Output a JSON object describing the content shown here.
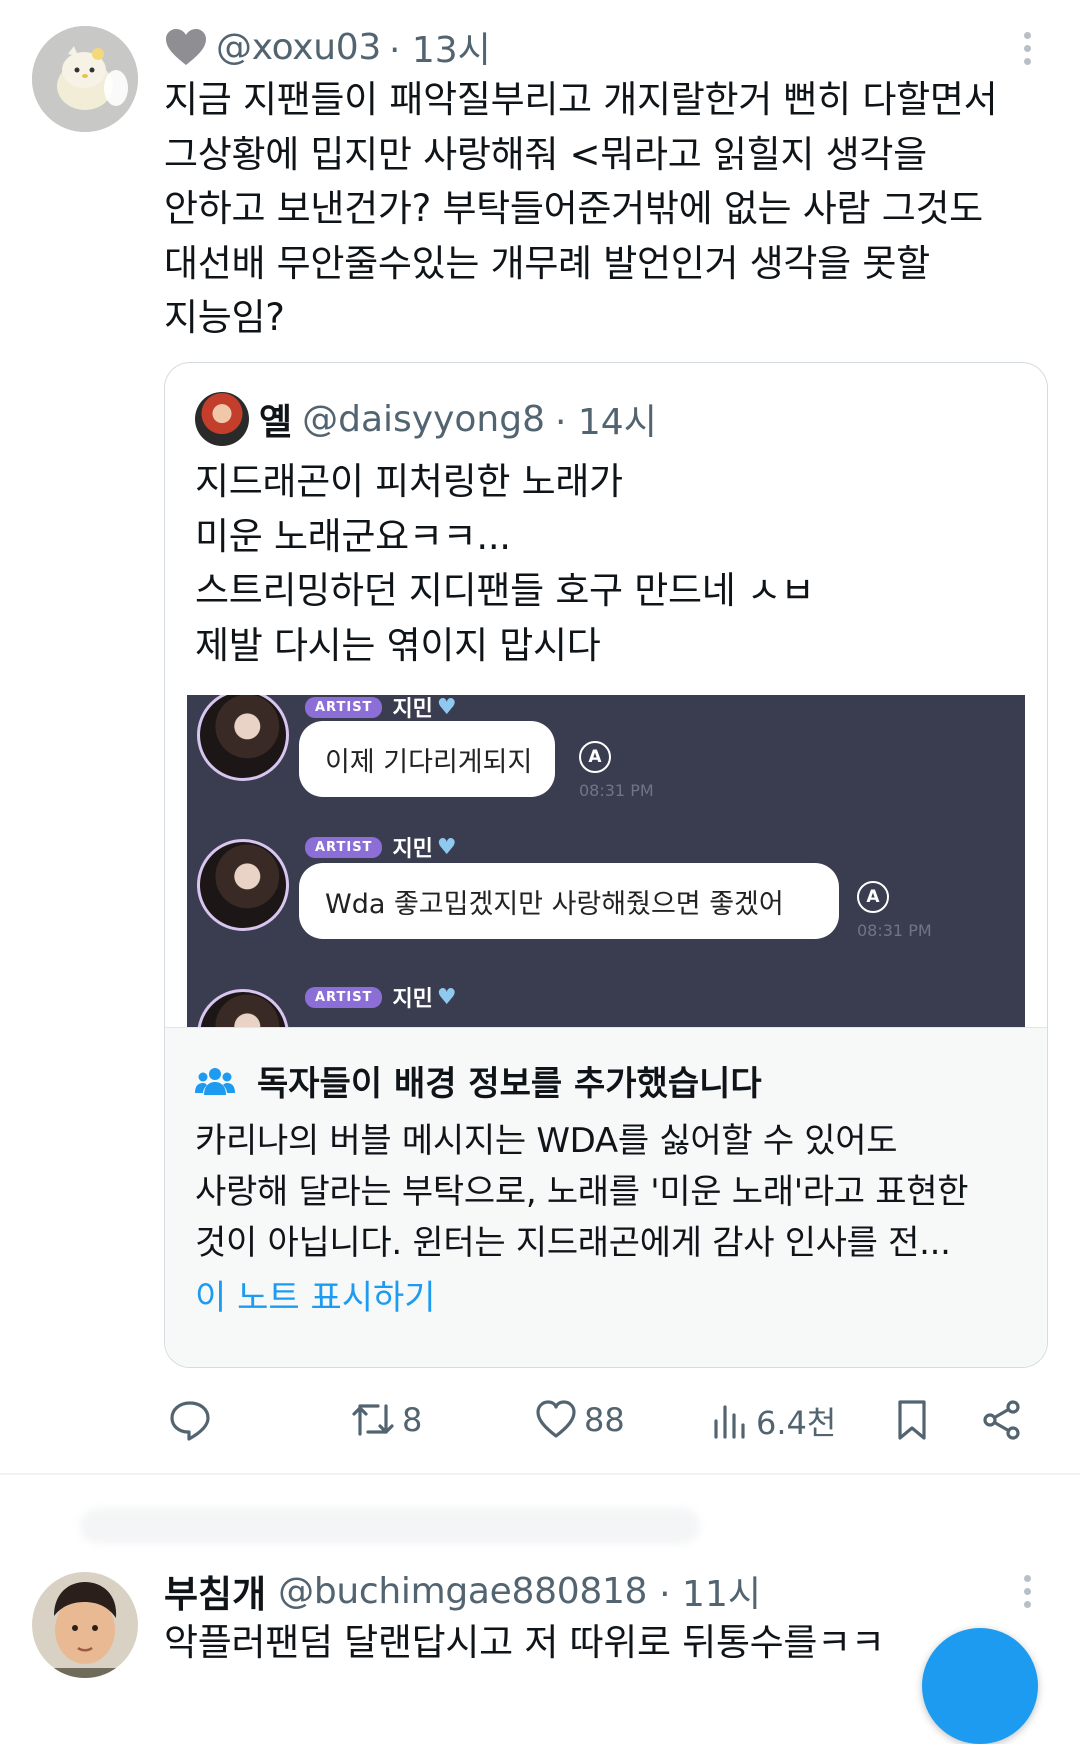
{
  "tweet1": {
    "handle": "@xoxu03",
    "time": "· 13시",
    "badge_icon": "grey-heart-icon",
    "text": "지금 지팬들이 패악질부리고 개지랄한거 뻔히 다할면서\n그상황에 밉지만 사랑해줘 <뭐라고 읽힐지 생각을\n안하고 보낸건가? 부탁들어준거밖에 없는 사람 그것도\n대선배 무안줄수있는 개무례 발언인거 생각을 못할\n지능임?"
  },
  "quote": {
    "name": "옐",
    "handle": "@daisyyong8",
    "time": "· 14시",
    "text": "지드래곤이 피처링한 노래가\n미운 노래군요ㅋㅋ...\n스트리밍하던 지디팬들 호구 만드네 ㅅㅂ\n제발 다시는 엮이지 맙시다",
    "chat": {
      "badge": "ARTIST",
      "name": "지민",
      "heart_icon": "blue-heart-icon",
      "messages": [
        {
          "text": "이제 기다리게되지",
          "time": "08:31 PM"
        },
        {
          "text": "Wda 좋고밉겠지만 사랑해줬으면 좋겠어",
          "time": "08:31 PM"
        }
      ]
    }
  },
  "community_note": {
    "icon": "people-icon",
    "title": "독자들이 배경 정보를 추가했습니다",
    "text": "카리나의 버블 메시지는 WDA를 싫어할 수 있어도\n사랑해 달라는 부탁으로, 노래를 '미운 노래'라고 표현한\n것이 아닙니다. 윈터는 지드래곤에게 감사 인사를 전...",
    "link": "이 노트 표시하기",
    "link_color": "#1d9bf0"
  },
  "actions": {
    "reply_icon": "reply-icon",
    "retweet_icon": "retweet-icon",
    "retweets": "8",
    "like_icon": "heart-icon",
    "likes": "88",
    "views_icon": "views-icon",
    "views": "6.4천",
    "bookmark_icon": "bookmark-icon",
    "share_icon": "share-icon"
  },
  "tweet2": {
    "name": "부침개",
    "handle": "@buchimgae880818",
    "time": "· 11시",
    "text": "악플러팬덤 달랜답시고 저 따위로 뒤통수를ㅋㅋ"
  },
  "colors": {
    "accent": "#1d9bf0",
    "muted": "#536471",
    "chat_bg": "#3a3d4f"
  }
}
